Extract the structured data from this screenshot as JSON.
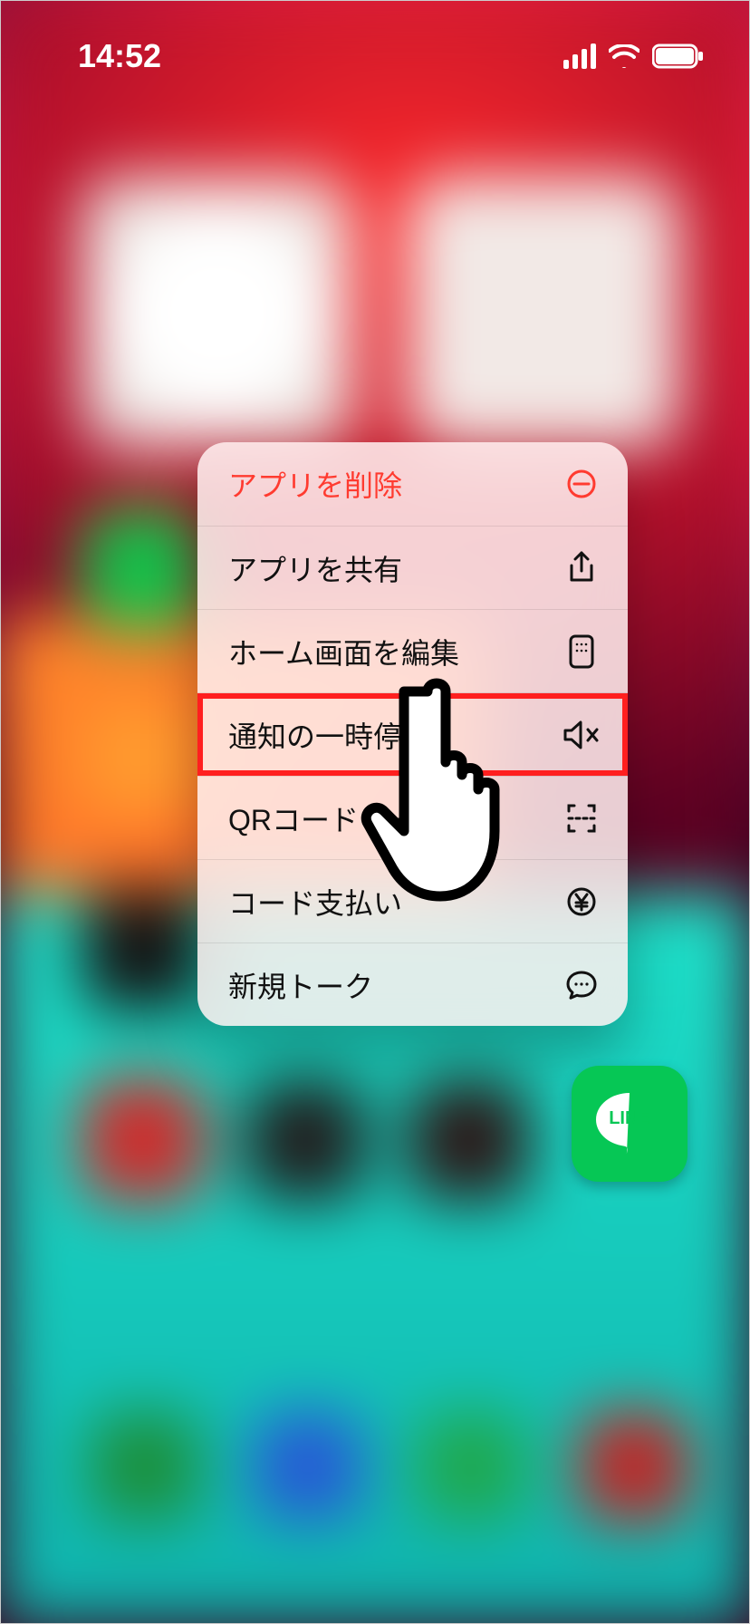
{
  "status": {
    "time": "14:52"
  },
  "menu": {
    "items": [
      {
        "label": "アプリを削除",
        "icon": "minus-circle-icon",
        "destructive": true,
        "highlight": false
      },
      {
        "label": "アプリを共有",
        "icon": "share-icon",
        "destructive": false,
        "highlight": false
      },
      {
        "label": "ホーム画面を編集",
        "icon": "edit-home-icon",
        "destructive": false,
        "highlight": false
      },
      {
        "label": "通知の一時停止",
        "icon": "mute-icon",
        "destructive": false,
        "highlight": true
      },
      {
        "label": "QRコードリーダー",
        "icon": "scan-icon",
        "destructive": false,
        "highlight": false
      },
      {
        "label": "コード支払い",
        "icon": "yen-circle-icon",
        "destructive": false,
        "highlight": false
      },
      {
        "label": "新規トーク",
        "icon": "chat-icon",
        "destructive": false,
        "highlight": false
      }
    ]
  },
  "app": {
    "name": "LINE"
  }
}
